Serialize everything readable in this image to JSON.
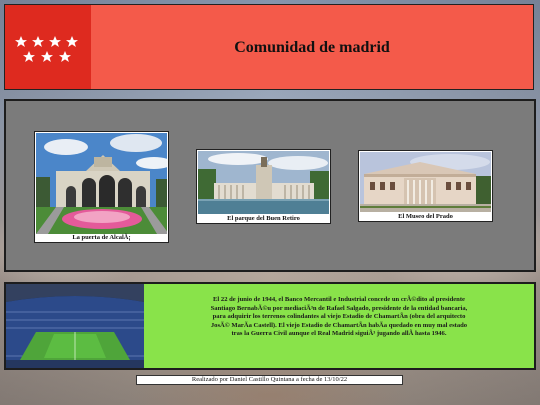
{
  "header": {
    "title": "Comunidad de madrid",
    "flag_colors": {
      "field": "#de2a1f",
      "stars": "#ffffff"
    },
    "background_color": "#f45a4a"
  },
  "gallery": {
    "background_color": "#7b7b7b",
    "cards": [
      {
        "caption": "La puerta de AlcalÃ¡",
        "icon": "puerta-de-alcala-photo"
      },
      {
        "caption": "El parque del Buen Retiro",
        "icon": "buen-retiro-photo"
      },
      {
        "caption": "El Museo del Prado",
        "icon": "museo-del-prado-photo"
      }
    ]
  },
  "story": {
    "background_color": "#89e34a",
    "lines": [
      "El 22 de junio de 1944, el Banco Mercantil e Industrial concede un crÃ©dito al presidente",
      "Santiago BernabÃ©u por mediaciÃ³n de Rafael Salgado, presidente de la entidad bancaria,",
      "para adquirir los terrenos colindantes al viejo Estadio de ChamartÃ­n (obra del arquitecto",
      "JosÃ© MarÃ­a Castell). El viejo Estadio de ChamartÃ­n habÃ­a quedado en muy mal estado",
      "tras la Guerra Civil aunque el Real Madrid siguiÃ³ jugando allÃ­ hasta 1946."
    ],
    "icon": "stadium-photo"
  },
  "footer": {
    "text": "Realizado por Daniel Castillo Quintana a fecha de 13/10/22"
  }
}
